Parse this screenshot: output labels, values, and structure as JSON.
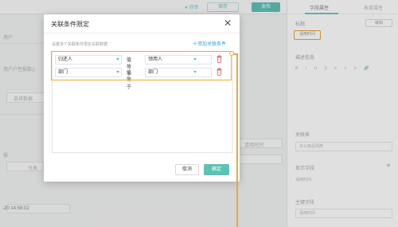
{
  "background": {
    "top_buttons": [
      "● 待审",
      "保存",
      "发布"
    ],
    "left_texts": [
      "用户",
      "用户户性报数()",
      "选择数据",
      "报",
      "分类",
      "-20 14:58:02"
    ],
    "right_texts": [
      "请用时间"
    ]
  },
  "props_panel": {
    "tabs": [
      "字段属性",
      "表单属性"
    ],
    "title_label": "标题",
    "edit_button": "编辑",
    "highlighted_tag": "请用时间",
    "desc_label": "描述信息",
    "toolbar_glyphs": "B I U S ≡ ≡ ≡ 🔗",
    "relation_table_label": "关联表",
    "relation_table_value": "办公用品领用",
    "display_field_label": "显示字段",
    "display_field_value": "请用时间",
    "main_field_label": "主键字段",
    "main_field_value": "请用时间"
  },
  "modal": {
    "title": "关联条件限定",
    "hint": "设置多个关联条件限定关联数据",
    "add_condition": "十添加关联条件",
    "conditions": [
      {
        "field": "归还人",
        "operator": "值等于",
        "value": "领用人"
      },
      {
        "field": "部门",
        "operator": "值等于",
        "value": "部门"
      }
    ],
    "cancel_label": "取消",
    "ok_label": "确定"
  },
  "colors": {
    "accent": "#5dc2b5",
    "highlight": "#f0a536",
    "delete": "#e25c5c",
    "link": "#3a9fd6"
  }
}
